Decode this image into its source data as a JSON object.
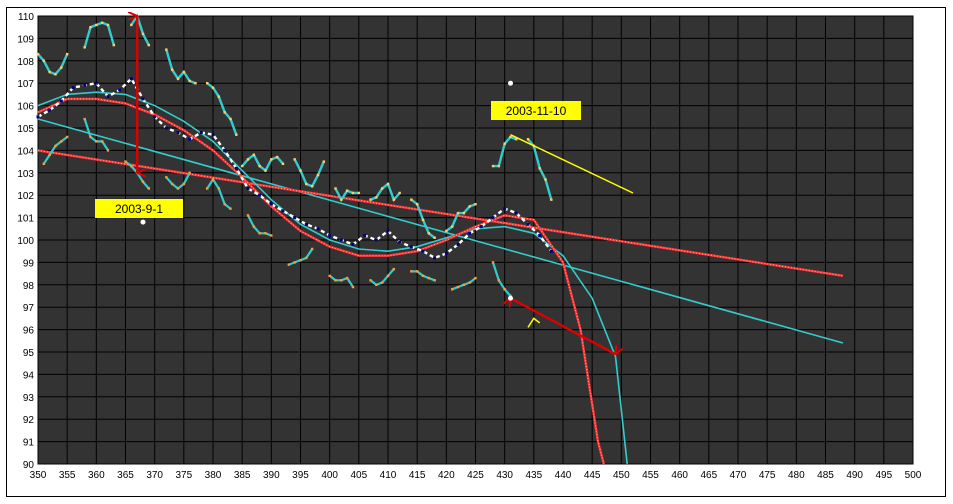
{
  "chart_data": {
    "type": "line",
    "title": "",
    "xlabel": "",
    "ylabel": "",
    "xlim": [
      350,
      500
    ],
    "ylim": [
      90,
      110
    ],
    "grid": true,
    "x_ticks": [
      350,
      355,
      360,
      365,
      370,
      375,
      380,
      385,
      390,
      395,
      400,
      405,
      410,
      415,
      420,
      425,
      430,
      435,
      440,
      445,
      450,
      455,
      460,
      465,
      470,
      475,
      480,
      485,
      490,
      495,
      500
    ],
    "y_ticks": [
      90,
      91,
      92,
      93,
      94,
      95,
      96,
      97,
      98,
      99,
      100,
      101,
      102,
      103,
      104,
      105,
      106,
      107,
      108,
      109,
      110
    ],
    "colors": {
      "plot_bg": "#333333",
      "grid": "#000000",
      "cyan": "#33cccc",
      "red": "#ff3333",
      "yellow": "#ffff00",
      "arrow": "#dd0000",
      "label_bg": "#ffff00",
      "dark_blue": "#000080",
      "white": "#ffffff"
    },
    "series": [
      {
        "values": [
          [
            350,
            105.4
          ],
          [
            488,
            95.4
          ]
        ]
      },
      {
        "values": [
          [
            350,
            104.0
          ],
          [
            488,
            98.4
          ]
        ]
      },
      {
        "values": [
          [
            350,
            106.0
          ],
          [
            355,
            106.5
          ],
          [
            360,
            106.6
          ],
          [
            365,
            106.5
          ],
          [
            370,
            106.0
          ],
          [
            375,
            105.3
          ],
          [
            380,
            104.4
          ],
          [
            385,
            103.1
          ],
          [
            390,
            101.8
          ],
          [
            395,
            100.7
          ],
          [
            400,
            100.0
          ],
          [
            405,
            99.6
          ],
          [
            410,
            99.5
          ],
          [
            415,
            99.7
          ],
          [
            420,
            100.1
          ],
          [
            425,
            100.5
          ],
          [
            430,
            100.6
          ],
          [
            435,
            100.3
          ],
          [
            440,
            99.3
          ],
          [
            445,
            97.4
          ],
          [
            449,
            94.8
          ],
          [
            451,
            90.0
          ]
        ]
      },
      {
        "values": [
          [
            350,
            105.7
          ],
          [
            355,
            106.3
          ],
          [
            360,
            106.3
          ],
          [
            365,
            106.1
          ],
          [
            370,
            105.6
          ],
          [
            375,
            104.9
          ],
          [
            380,
            104.0
          ],
          [
            385,
            102.8
          ],
          [
            390,
            101.5
          ],
          [
            395,
            100.4
          ],
          [
            400,
            99.7
          ],
          [
            405,
            99.3
          ],
          [
            410,
            99.3
          ],
          [
            415,
            99.5
          ],
          [
            420,
            100.0
          ],
          [
            425,
            100.6
          ],
          [
            430,
            101.1
          ],
          [
            435,
            100.9
          ],
          [
            440,
            99.0
          ],
          [
            443,
            96.0
          ],
          [
            446,
            91.0
          ],
          [
            447,
            90.0
          ]
        ]
      },
      {
        "values": [
          [
            350,
            105.5
          ],
          [
            352,
            105.8
          ],
          [
            354,
            106.2
          ],
          [
            356,
            106.8
          ],
          [
            358,
            106.9
          ],
          [
            360,
            107.0
          ],
          [
            362,
            106.4
          ],
          [
            364,
            106.7
          ],
          [
            366,
            107.2
          ],
          [
            368,
            106.3
          ],
          [
            370,
            105.5
          ],
          [
            372,
            105.0
          ],
          [
            374,
            104.8
          ],
          [
            376,
            104.5
          ],
          [
            378,
            104.8
          ],
          [
            380,
            104.7
          ],
          [
            382,
            104.0
          ],
          [
            384,
            103.2
          ],
          [
            386,
            102.3
          ],
          [
            388,
            102.0
          ],
          [
            390,
            101.6
          ],
          [
            392,
            101.3
          ],
          [
            394,
            101.0
          ],
          [
            396,
            100.7
          ],
          [
            398,
            100.5
          ],
          [
            400,
            100.2
          ],
          [
            402,
            100.0
          ],
          [
            404,
            99.8
          ],
          [
            406,
            100.2
          ],
          [
            408,
            100.0
          ],
          [
            410,
            100.4
          ],
          [
            412,
            99.9
          ],
          [
            414,
            99.7
          ],
          [
            416,
            99.5
          ],
          [
            418,
            99.2
          ],
          [
            420,
            99.4
          ],
          [
            422,
            99.8
          ],
          [
            424,
            100.3
          ],
          [
            426,
            100.6
          ],
          [
            428,
            101.0
          ],
          [
            430,
            101.4
          ],
          [
            432,
            101.2
          ],
          [
            434,
            100.7
          ],
          [
            436,
            100.2
          ],
          [
            438,
            99.5
          ]
        ]
      },
      {
        "values": [
          [
            350,
            108.3
          ],
          [
            351,
            108.0
          ],
          [
            352,
            107.5
          ],
          [
            353,
            107.4
          ],
          [
            354,
            107.7
          ],
          [
            355,
            108.3
          ]
        ]
      },
      {
        "values": [
          [
            358,
            108.6
          ],
          [
            359,
            109.5
          ],
          [
            360,
            109.6
          ],
          [
            361,
            109.7
          ],
          [
            362,
            109.6
          ],
          [
            363,
            108.7
          ]
        ]
      },
      {
        "values": [
          [
            366,
            109.6
          ],
          [
            367,
            110.0
          ],
          [
            368,
            109.2
          ],
          [
            369,
            108.7
          ]
        ]
      },
      {
        "values": [
          [
            372,
            108.5
          ],
          [
            373,
            107.6
          ],
          [
            374,
            107.2
          ],
          [
            375,
            107.5
          ],
          [
            376,
            107.1
          ],
          [
            377,
            107.0
          ]
        ]
      },
      {
        "values": [
          [
            379,
            107.0
          ],
          [
            380,
            106.8
          ],
          [
            381,
            106.4
          ],
          [
            382,
            105.7
          ],
          [
            383,
            105.4
          ],
          [
            384,
            104.7
          ]
        ]
      },
      {
        "values": [
          [
            385,
            103.3
          ],
          [
            386,
            103.6
          ],
          [
            387,
            103.8
          ],
          [
            388,
            103.3
          ],
          [
            389,
            103.1
          ],
          [
            390,
            103.6
          ],
          [
            391,
            103.7
          ],
          [
            392,
            103.4
          ]
        ]
      },
      {
        "values": [
          [
            394,
            103.6
          ],
          [
            395,
            103.1
          ],
          [
            396,
            102.5
          ],
          [
            397,
            102.4
          ],
          [
            398,
            102.9
          ],
          [
            399,
            103.5
          ]
        ]
      },
      {
        "values": [
          [
            401,
            102.3
          ],
          [
            402,
            101.8
          ],
          [
            403,
            102.2
          ],
          [
            404,
            102.1
          ],
          [
            405,
            102.1
          ]
        ]
      },
      {
        "values": [
          [
            407,
            101.8
          ],
          [
            408,
            101.9
          ],
          [
            409,
            102.3
          ],
          [
            410,
            102.5
          ],
          [
            411,
            101.8
          ],
          [
            412,
            102.1
          ]
        ]
      },
      {
        "values": [
          [
            414,
            101.8
          ],
          [
            415,
            101.6
          ],
          [
            416,
            100.9
          ],
          [
            417,
            100.3
          ],
          [
            418,
            100.1
          ]
        ]
      },
      {
        "values": [
          [
            420,
            100.4
          ],
          [
            421,
            100.6
          ],
          [
            422,
            101.2
          ],
          [
            423,
            101.2
          ],
          [
            424,
            101.5
          ],
          [
            425,
            101.6
          ]
        ]
      },
      {
        "values": [
          [
            428,
            103.3
          ],
          [
            429,
            103.3
          ],
          [
            430,
            104.3
          ],
          [
            431,
            104.6
          ],
          [
            432,
            104.5
          ]
        ]
      },
      {
        "values": [
          [
            434,
            104.5
          ],
          [
            435,
            104.2
          ],
          [
            436,
            103.2
          ],
          [
            437,
            102.7
          ],
          [
            438,
            101.8
          ]
        ]
      },
      {
        "values": [
          [
            351,
            103.4
          ],
          [
            352,
            103.8
          ],
          [
            353,
            104.2
          ],
          [
            354,
            104.4
          ],
          [
            355,
            104.6
          ]
        ]
      },
      {
        "values": [
          [
            358,
            105.4
          ],
          [
            359,
            104.6
          ],
          [
            360,
            104.4
          ],
          [
            361,
            104.4
          ],
          [
            362,
            104.0
          ]
        ]
      },
      {
        "values": [
          [
            365,
            103.5
          ],
          [
            366,
            103.3
          ],
          [
            367,
            103.0
          ],
          [
            368,
            102.6
          ],
          [
            369,
            102.3
          ]
        ]
      },
      {
        "values": [
          [
            372,
            102.8
          ],
          [
            373,
            102.5
          ],
          [
            374,
            102.3
          ],
          [
            375,
            102.5
          ],
          [
            376,
            103.0
          ]
        ]
      },
      {
        "values": [
          [
            379,
            102.3
          ],
          [
            380,
            102.7
          ],
          [
            381,
            102.3
          ],
          [
            382,
            101.6
          ],
          [
            383,
            101.4
          ]
        ]
      },
      {
        "values": [
          [
            386,
            101.1
          ],
          [
            387,
            100.6
          ],
          [
            388,
            100.3
          ],
          [
            389,
            100.3
          ],
          [
            390,
            100.2
          ]
        ]
      },
      {
        "values": [
          [
            393,
            98.9
          ],
          [
            394,
            99.0
          ],
          [
            395,
            99.1
          ],
          [
            396,
            99.2
          ],
          [
            397,
            99.6
          ]
        ]
      },
      {
        "values": [
          [
            400,
            98.4
          ],
          [
            401,
            98.2
          ],
          [
            402,
            98.2
          ],
          [
            403,
            98.3
          ],
          [
            404,
            97.9
          ]
        ]
      },
      {
        "values": [
          [
            407,
            98.2
          ],
          [
            408,
            98.0
          ],
          [
            409,
            98.1
          ],
          [
            410,
            98.4
          ],
          [
            411,
            98.7
          ]
        ]
      },
      {
        "values": [
          [
            414,
            98.6
          ],
          [
            415,
            98.6
          ],
          [
            416,
            98.4
          ],
          [
            417,
            98.3
          ],
          [
            418,
            98.2
          ]
        ]
      },
      {
        "values": [
          [
            421,
            97.8
          ],
          [
            422,
            97.9
          ],
          [
            423,
            98.0
          ],
          [
            424,
            98.1
          ],
          [
            425,
            98.3
          ]
        ]
      },
      {
        "values": [
          [
            428,
            99.0
          ],
          [
            429,
            98.2
          ],
          [
            430,
            97.8
          ],
          [
            431,
            97.5
          ]
        ]
      },
      {
        "values": [
          [
            434,
            96.1
          ],
          [
            435,
            96.5
          ],
          [
            436,
            96.3
          ]
        ]
      },
      {
        "values": [
          [
            431,
            104.7
          ],
          [
            452,
            102.1
          ]
        ]
      },
      {
        "values": [
          [
            431,
            97.4
          ],
          [
            449,
            94.9
          ]
        ]
      },
      {
        "values": [
          [
            367,
            103.0
          ],
          [
            367,
            110.0
          ]
        ]
      },
      {
        "values": [
          [
            431,
            97.4
          ],
          [
            431,
            104.7
          ]
        ]
      },
      {
        "values": [
          [
            368,
            100.8
          ]
        ]
      },
      {
        "values": [
          [
            431,
            107.0
          ]
        ]
      }
    ],
    "annotations": [
      {
        "text": "2003-9-1"
      },
      {
        "text": "2003-11-10"
      }
    ]
  }
}
